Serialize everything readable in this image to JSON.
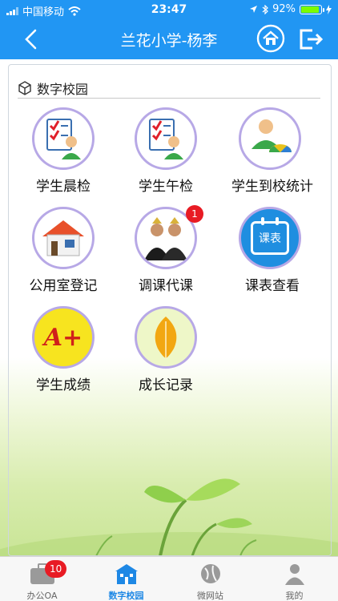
{
  "status_bar": {
    "carrier": "中国移动",
    "time": "23:47",
    "battery": "92%"
  },
  "nav": {
    "title": "兰花小学-杨李"
  },
  "section": {
    "title": "数字校园"
  },
  "tiles": [
    {
      "label": "学生晨检"
    },
    {
      "label": "学生午检"
    },
    {
      "label": "学生到校统计"
    },
    {
      "label": "公用室登记"
    },
    {
      "label": "调课代课",
      "badge": "1"
    },
    {
      "label": "课表查看",
      "icon_text": "课表"
    },
    {
      "label": "学生成绩",
      "icon_text": "A+"
    },
    {
      "label": "成长记录"
    }
  ],
  "tabbar": [
    {
      "label": "办公OA",
      "badge": "10"
    },
    {
      "label": "数字校园"
    },
    {
      "label": "微网站"
    },
    {
      "label": "我的"
    }
  ],
  "colors": {
    "header": "#2196f3",
    "ring": "#b7a8e6",
    "badge": "#e81b24",
    "active_tab": "#1e88e5"
  }
}
